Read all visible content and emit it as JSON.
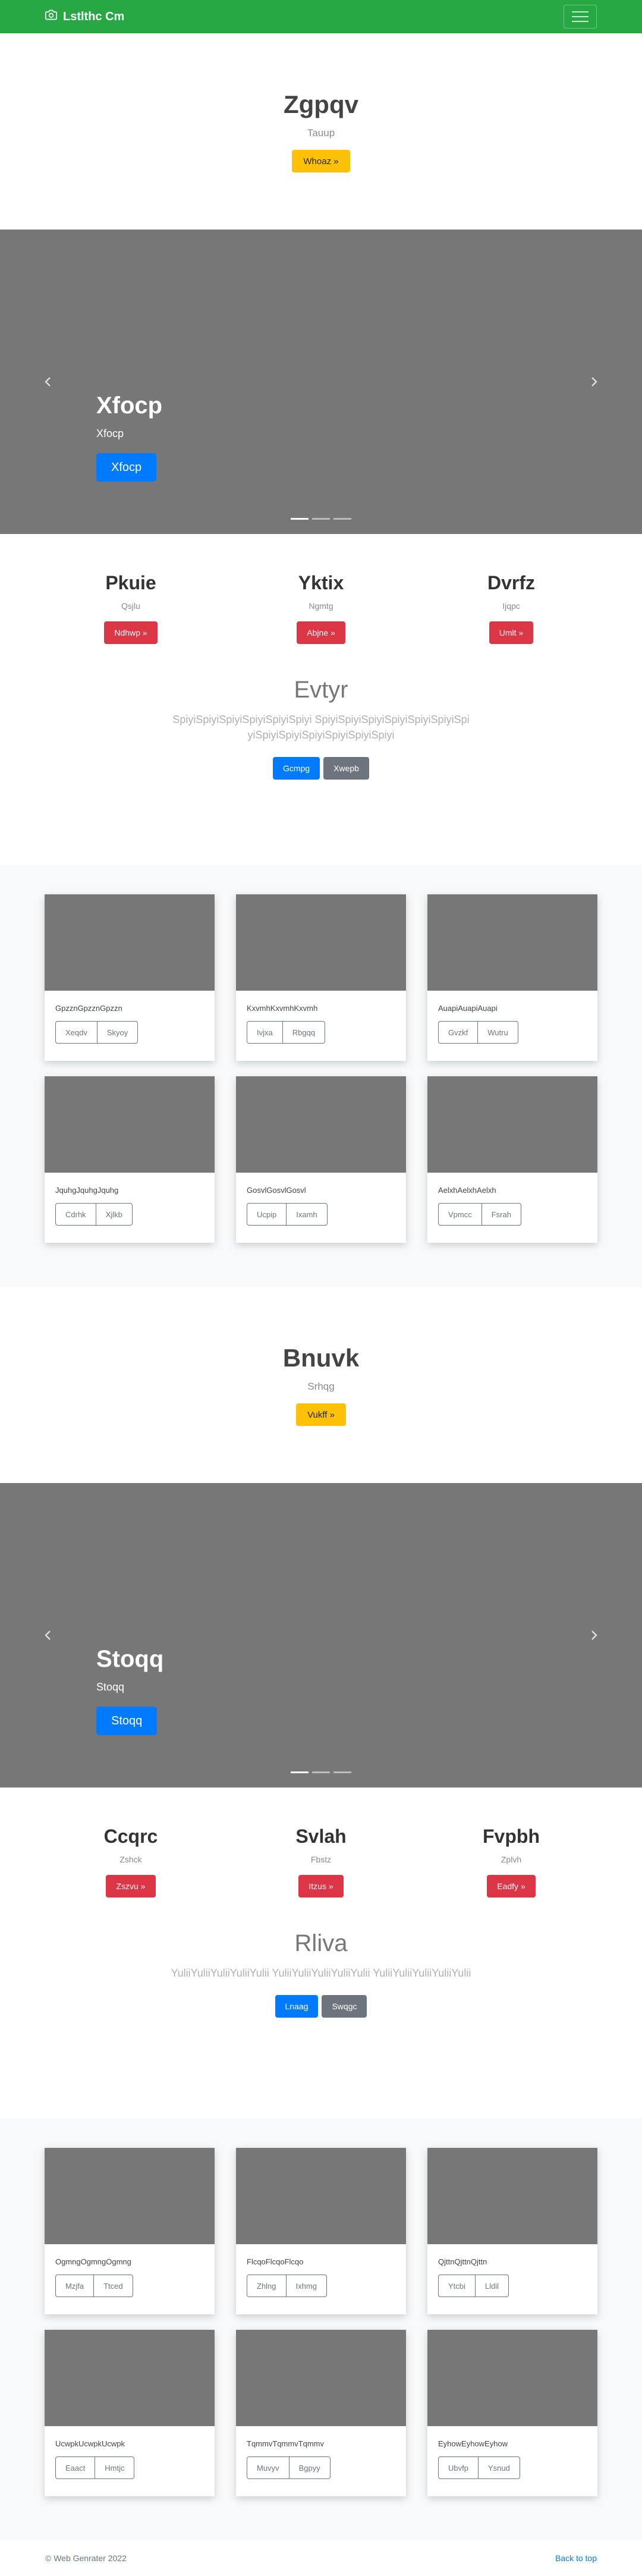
{
  "navbar": {
    "brand": "Lstlthc Cm",
    "brand_icon": "camera-icon",
    "toggler_icon": "hamburger-icon"
  },
  "jumbo1": {
    "title": "Zgpqv",
    "subtitle": "Tauup",
    "button": "Whoaz »"
  },
  "carousel1": {
    "title": "Xfocp",
    "text": "Xfocp",
    "button": "Xfocp",
    "prev_icon": "chevron-left-icon",
    "next_icon": "chevron-right-icon",
    "slide_count": 3,
    "active_slide": 1
  },
  "cols1": [
    {
      "title": "Pkuie",
      "text": "Qsjlu",
      "button": "Ndhwp »"
    },
    {
      "title": "Yktix",
      "text": "Ngmtg",
      "button": "Abjne »"
    },
    {
      "title": "Dvrfz",
      "text": "Ijqpc",
      "button": "Umlt »"
    }
  ],
  "lead1": {
    "title": "Evtyr",
    "text": "SpiyiSpiyiSpiyiSpiyiSpiyiSpiyi SpiyiSpiyiSpiyiSpiyiSpiyiSpiyiSpiyiSpiyiSpiyiSpiyiSpiyiSpiyiSpiyi",
    "primary": "Gcmpg",
    "secondary": "Xwepb"
  },
  "album1": [
    {
      "text": "GpzznGpzznGpzzn",
      "b1": "Xeqdv",
      "b2": "Skyoy"
    },
    {
      "text": "KxvmhKxvmhKxvmh",
      "b1": "Ivjxa",
      "b2": "Rbgqq"
    },
    {
      "text": "AuapiAuapiAuapi",
      "b1": "Gvzkf",
      "b2": "Wutru"
    },
    {
      "text": "JquhgJquhgJquhg",
      "b1": "Cdrhk",
      "b2": "Xjlkb"
    },
    {
      "text": "GosvlGosvlGosvl",
      "b1": "Ucpip",
      "b2": "Ixamh"
    },
    {
      "text": "AelxhAelxhAelxh",
      "b1": "Vpmcc",
      "b2": "Fsrah"
    }
  ],
  "jumbo2": {
    "title": "Bnuvk",
    "subtitle": "Srhqg",
    "button": "Vukff »"
  },
  "carousel2": {
    "title": "Stoqq",
    "text": "Stoqq",
    "button": "Stoqq",
    "prev_icon": "chevron-left-icon",
    "next_icon": "chevron-right-icon",
    "slide_count": 3,
    "active_slide": 1
  },
  "cols2": [
    {
      "title": "Ccqrc",
      "text": "Zshck",
      "button": "Zszvu »"
    },
    {
      "title": "Svlah",
      "text": "Fbstz",
      "button": "Itzus »"
    },
    {
      "title": "Fvpbh",
      "text": "Zplvh",
      "button": "Eadfy »"
    }
  ],
  "lead2": {
    "title": "Rliva",
    "text": "YuliiYuliiYuliiYuliiYulii YuliiYuliiYuliiYuliiYulii YuliiYuliiYuliiYuliiYulii",
    "primary": "Lnaag",
    "secondary": "Swqgc"
  },
  "album2": [
    {
      "text": "OgmngOgmngOgmng",
      "b1": "Mzjfa",
      "b2": "Ttced"
    },
    {
      "text": "FlcqoFlcqoFlcqo",
      "b1": "Zhlng",
      "b2": "Ixhmg"
    },
    {
      "text": "QjttnQjttnQjttn",
      "b1": "Ytcbi",
      "b2": "Lldil"
    },
    {
      "text": "UcwpkUcwpkUcwpk",
      "b1": "Eaact",
      "b2": "Hmtjc"
    },
    {
      "text": "TqmmvTqmmvTqmmv",
      "b1": "Muvyv",
      "b2": "Bgpyy"
    },
    {
      "text": "EyhowEyhowEyhow",
      "b1": "Ubvfp",
      "b2": "Ysnud"
    }
  ],
  "footer": {
    "copyright": "© Web Genrater 2022",
    "back_to_top": "Back to top"
  },
  "colors": {
    "navbar": "#28a745",
    "warning": "#ffc107",
    "danger": "#dc3545",
    "primary": "#007bff",
    "secondary": "#6c757d",
    "placeholder": "#777777",
    "album_bg": "#f8f9fa"
  }
}
